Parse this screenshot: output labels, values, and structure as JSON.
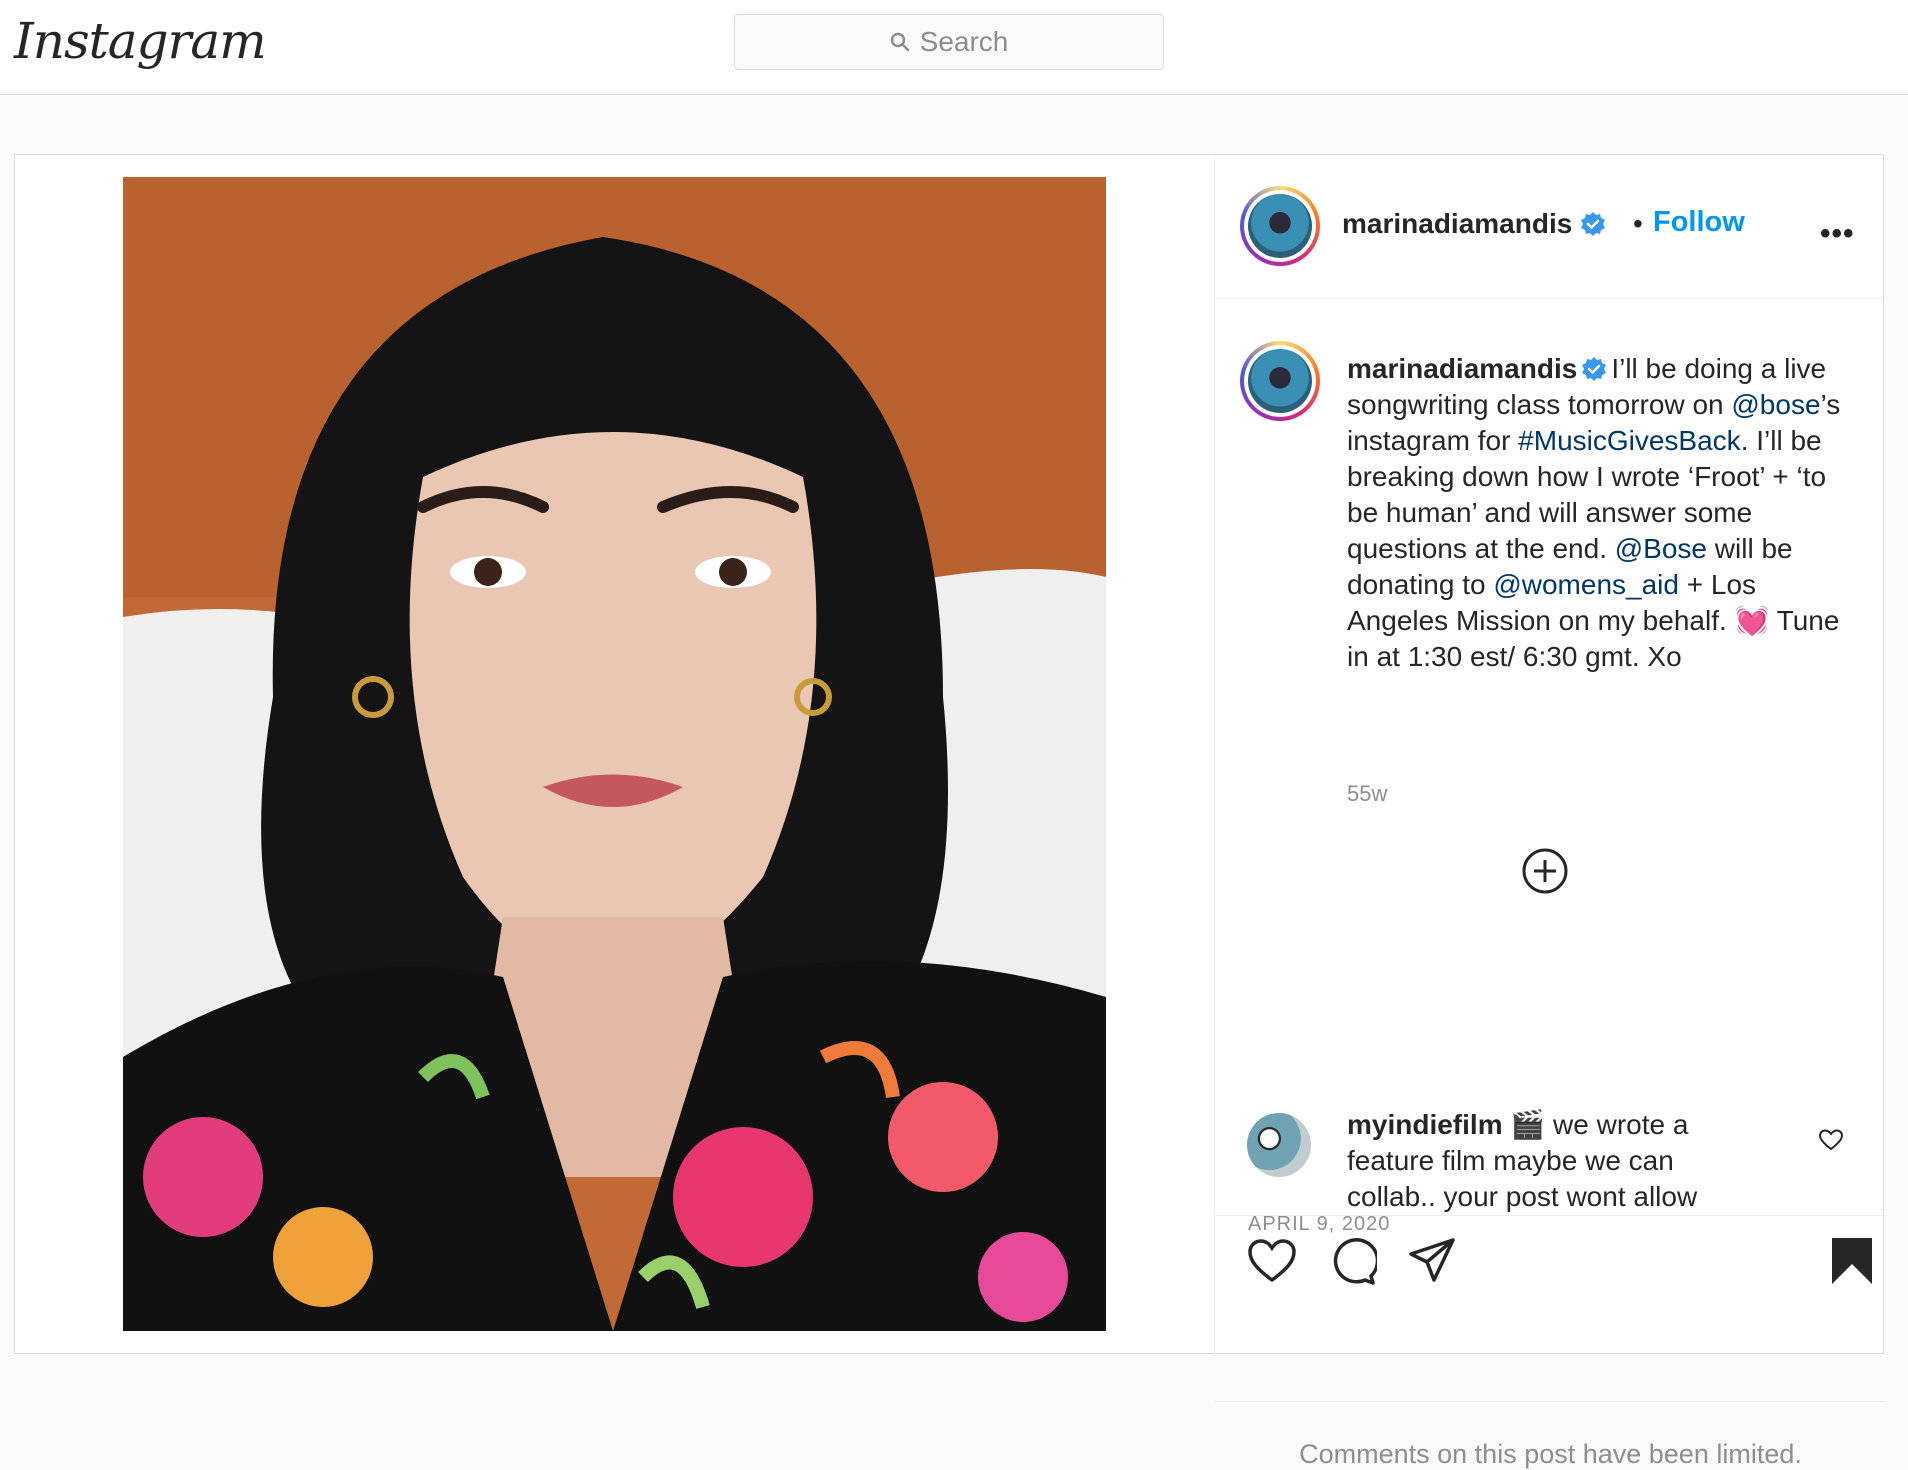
{
  "brand": {
    "logo_text": "Instagram"
  },
  "search": {
    "placeholder": "Search"
  },
  "post": {
    "author": "marinadiamandis",
    "follow_label": "Follow",
    "separator": "•",
    "more_label": "•••",
    "caption": {
      "username": "marinadiamandis",
      "segments": {
        "s1": "I’ll be doing a live songwriting class tomorrow on ",
        "m1": "@bose",
        "s2": "’s instagram for ",
        "h1": "#MusicGivesBack",
        "s3": ". I’ll be breaking down how I wrote ‘Froot’ + ‘to be human’ and will answer some questions at the end. ",
        "m2": "@Bose",
        "s4": " will be donating to ",
        "m3": "@womens_aid",
        "s5": " + Los Angeles Mission on my behalf. 💓 Tune in at 1:30 est/ 6:30 gmt. Xo"
      }
    },
    "age": "55w",
    "comment": {
      "username": "myindiefilm",
      "emoji": "🎬",
      "text": " we wrote a feature film maybe we can collab.. your post wont allow"
    },
    "date": "APRIL 9, 2020",
    "comments_limited": "Comments on this post have been limited."
  },
  "colors": {
    "accent": "#0095f6",
    "link": "#00376b",
    "muted": "#8e8e8e",
    "border": "#dbdbdb"
  },
  "icons": {
    "search": "search-icon",
    "verified": "verified-badge-icon",
    "load_more": "plus-circle-icon",
    "like": "heart-icon",
    "comment": "comment-icon",
    "share": "paper-plane-icon",
    "save": "bookmark-filled-icon"
  }
}
